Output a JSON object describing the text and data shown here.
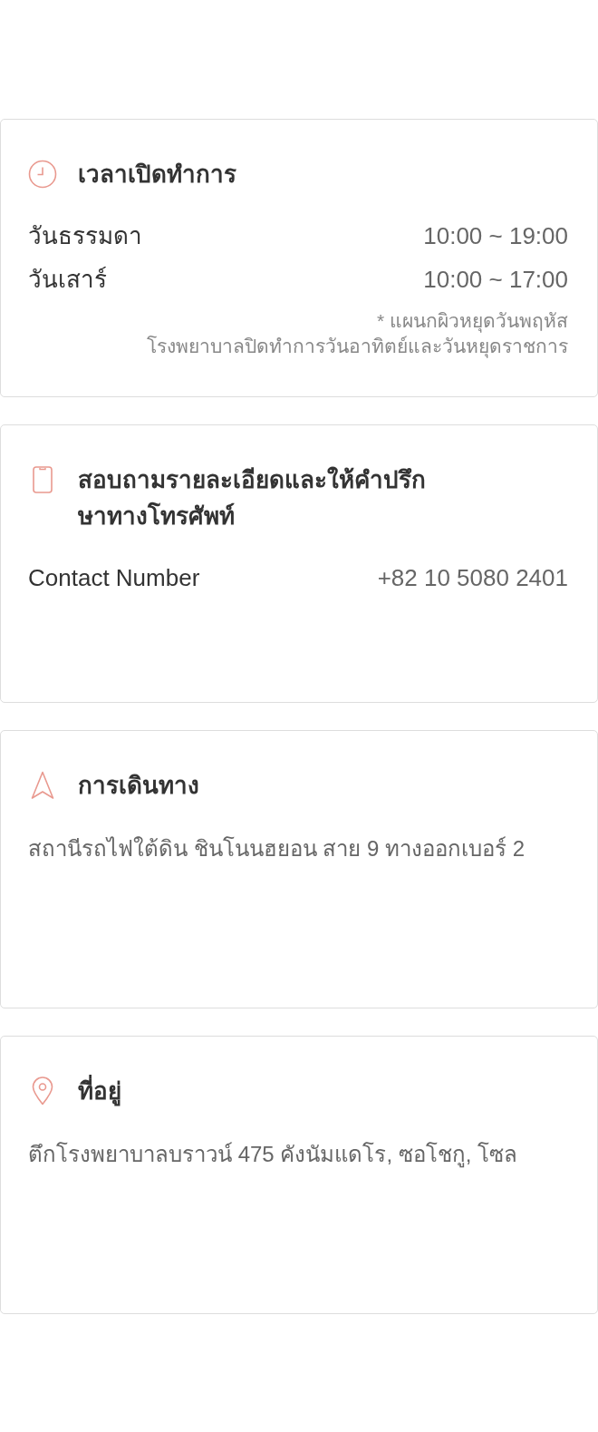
{
  "cards": [
    {
      "kind": "hours",
      "title": "เวลาเปิดทำการ",
      "rows": [
        {
          "label": "วันธรรมดา",
          "value": "10:00 ~ 19:00"
        },
        {
          "label": "วันเสาร์",
          "value": "10:00 ~ 17:00"
        }
      ],
      "notes": [
        "* แผนกผิวหยุดวันพฤหัส",
        "โรงพยาบาลปิดทำการวันอาทิตย์และวันหยุดราชการ"
      ]
    },
    {
      "kind": "phone",
      "title": "สอบถามรายละเอียดและให้คำปรึกษาทางโทรศัพท์",
      "rows": [
        {
          "label": "Contact Number",
          "value": "+82 10 5080 2401"
        }
      ]
    },
    {
      "kind": "directions",
      "title": "การเดินทาง",
      "text": "สถานีรถไฟใต้ดิน ชินโนนฮยอน สาย 9 ทางออกเบอร์ 2"
    },
    {
      "kind": "address",
      "title": "ที่อยู่",
      "text": "ตึกโรงพยาบาลบราวน์ 475 คังนัมแดโร, ซอโชกู, โซล"
    }
  ]
}
